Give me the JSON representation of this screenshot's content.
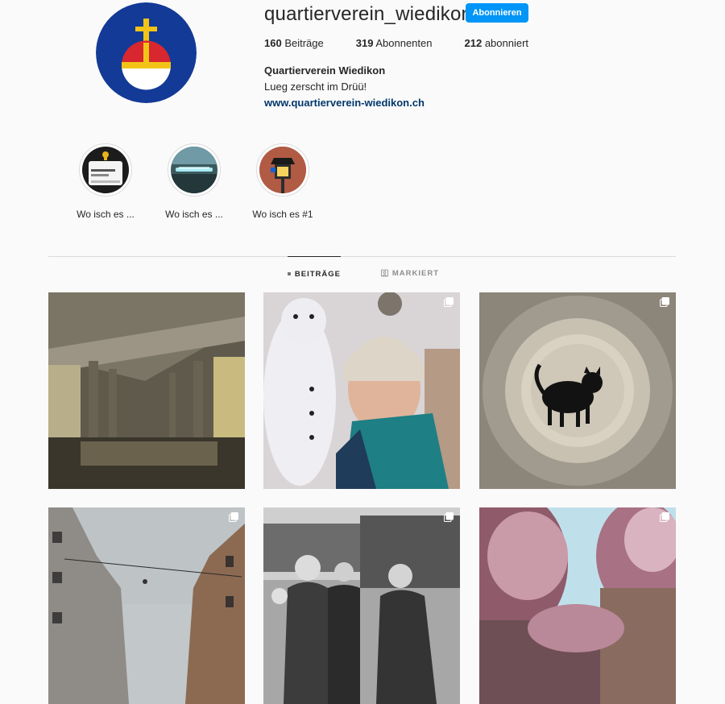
{
  "profile": {
    "username": "quartierverein_wiedikon",
    "follow_label": "Abonnieren",
    "stats": {
      "posts_count": "160",
      "posts_label": "Beiträge",
      "followers_count": "319",
      "followers_label": "Abonnenten",
      "following_count": "212",
      "following_label": "abonniert"
    },
    "full_name": "Quartierverein Wiedikon",
    "bio": "Lueg zerscht im Drüü!",
    "website": "www.quartierverein-wiedikon.ch",
    "avatar_icon": "orb-cross-coat-of-arms-icon",
    "accent_color": "#0095f6"
  },
  "highlights": [
    {
      "label": "Wo isch es ..."
    },
    {
      "label": "Wo isch es ..."
    },
    {
      "label": "Wo isch es #1"
    }
  ],
  "tabs": [
    {
      "label": "BEITRÄGE",
      "icon": "grid-icon",
      "active": true
    },
    {
      "label": "MARKIERT",
      "icon": "tagged-icon",
      "active": false
    }
  ],
  "posts": [
    {
      "scene": "concrete bridge over river in snow",
      "multi": false
    },
    {
      "scene": "woman with snowman selfie",
      "multi": true
    },
    {
      "scene": "black cat through glass",
      "multi": true
    },
    {
      "scene": "city street with buildings",
      "multi": true
    },
    {
      "scene": "black and white photo of people",
      "multi": true
    },
    {
      "scene": "street with blossoming trees",
      "multi": true
    }
  ]
}
